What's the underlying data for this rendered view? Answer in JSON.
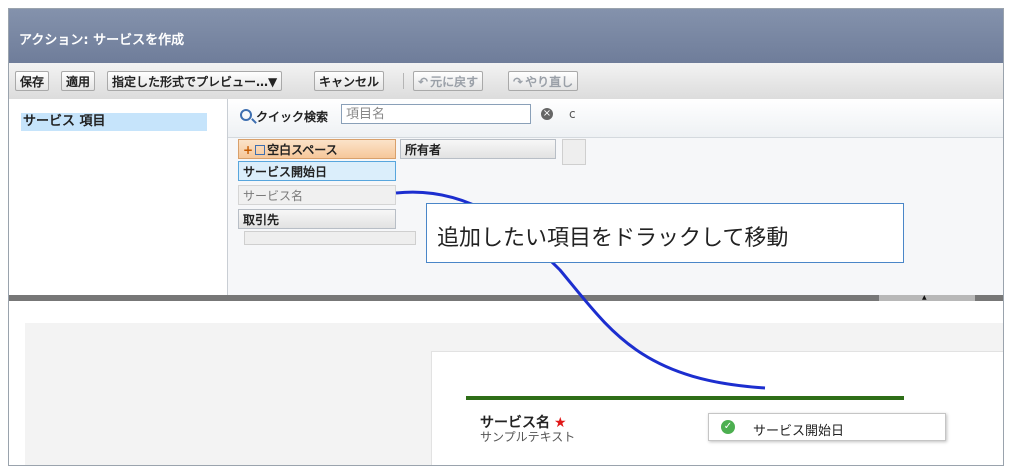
{
  "window": {
    "title": "アクション: サービスを作成"
  },
  "toolbar": {
    "save": "保存",
    "apply": "適用",
    "preview": "指定した形式でプレビュー…▼",
    "cancel": "キャンセル",
    "undo": "元に戻す",
    "redo": "やり直し"
  },
  "palette": {
    "category": "サービス 項目",
    "search": {
      "label": "クイック検索",
      "placeholder": "項目名"
    },
    "fields": {
      "blank": "空白スペース",
      "owner": "所有者",
      "start_date": "サービス開始日",
      "service_name": "サービス名",
      "account": "取引先"
    }
  },
  "layout": {
    "field_label": "サービス名",
    "required_mark": "★",
    "sample_text": "サンプルテキスト",
    "dragging_field": "サービス開始日"
  },
  "callout": {
    "text": "追加したい項目をドラックして移動"
  },
  "colors": {
    "titlebar": "#7b89a5",
    "drop_line": "#2e6e17",
    "callout_border": "#4a86c8",
    "curve": "#1c2ecf",
    "required": "#e01818",
    "check": "#4caf50"
  },
  "icons": [
    "search-icon",
    "clear-icon",
    "undo-icon",
    "redo-icon",
    "check-icon",
    "required-icon"
  ]
}
